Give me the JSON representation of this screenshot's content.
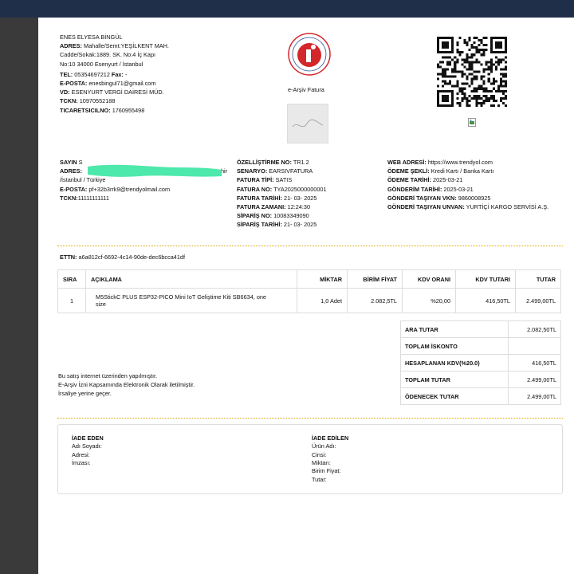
{
  "seller": {
    "name": "ENES ELYESA BİNGÜL",
    "address_label": "ADRES:",
    "address_lines": [
      "Mahalle/Semt:YEŞİLKENT MAH.",
      "Cadde/Sokak:1889. SK. No:4 İç Kapı",
      "No:10 34000 Esenyurt / İstanbul"
    ],
    "tel_label": "TEL:",
    "tel": "05354697212",
    "fax_label": "Fax:",
    "fax": "-",
    "email_label": "E-POSTA:",
    "email": "enesbingul71@gmail.com",
    "vd_label": "VD:",
    "vd": "ESENYURT VERGİ DAİRESİ MÜD.",
    "tckn_label": "TCKN:",
    "tckn": "10970552188",
    "ticsicil_label": "TICARETSICILNO:",
    "ticsicil": "1760955498"
  },
  "header": {
    "doc_type": "e-Arşiv Fatura"
  },
  "buyer": {
    "sayin_label": "SAYIN",
    "sayin_value": "S",
    "address_label": "ADRES:",
    "address_value": "hir",
    "address_line2": "/İstanbul / Türkiye",
    "email_label": "E-POSTA:",
    "email": "pf+32b3rrk9@trendyolmail.com",
    "tckn_label": "TCKN:",
    "tckn": "11111111111"
  },
  "invoice": {
    "rows": [
      {
        "label": "ÖZELLİŞTİRME NO:",
        "value": "TR1.2"
      },
      {
        "label": "SENARYO:",
        "value": "EARSIVFATURA"
      },
      {
        "label": "FATURA TİPİ:",
        "value": "SATIS"
      },
      {
        "label": "FATURA NO:",
        "value": "TYA2025000000001"
      },
      {
        "label": "FATURA TARİHİ:",
        "value": "21- 03- 2025"
      },
      {
        "label": "FATURA ZAMANI:",
        "value": "12:24:30"
      },
      {
        "label": "SİPARİŞ NO:",
        "value": "10083349090"
      },
      {
        "label": "SİPARİŞ TARİHİ:",
        "value": "21- 03- 2025"
      }
    ]
  },
  "shipping": {
    "rows": [
      {
        "label": "WEB ADRESİ:",
        "value": "https://www.trendyol.com"
      },
      {
        "label": "ÖDEME ŞEKLİ:",
        "value": "Kredi Kartı / Banka Kartı"
      },
      {
        "label": "ÖDEME TARİHİ:",
        "value": "2025-03-21"
      },
      {
        "label": "GÖNDERİM TARİHİ:",
        "value": "2025-03-21"
      },
      {
        "label": "GÖNDERİ TAŞIYAN VKN:",
        "value": "9860008925"
      },
      {
        "label": "GÖNDERİ TAŞIYAN UNVAN:",
        "value": "YURTİÇİ KARGO SERVİSİ A.Ş."
      }
    ]
  },
  "ettn": {
    "label": "ETTN:",
    "value": "a6a812cf-6692-4c14-90de-dec6bcca41df"
  },
  "items_table": {
    "headers": [
      "SIRA",
      "AÇIKLAMA",
      "MİKTAR",
      "BİRİM FİYAT",
      "KDV ORANI",
      "KDV TUTARI",
      "TUTAR"
    ],
    "rows": [
      {
        "sira": "1",
        "aciklama_1": "M5StickC PLUS ESP32-PICO Mini IoT Geliştime Kiti SB6634, one",
        "aciklama_2": "size",
        "miktar": "1,0 Adet",
        "birim_fiyat": "2.082,5TL",
        "kdv_orani": "%20,00",
        "kdv_tutari": "416,50TL",
        "tutar": "2.499,00TL"
      }
    ]
  },
  "totals": [
    {
      "label": "ARA TUTAR",
      "value": "2.082,50TL"
    },
    {
      "label": "TOPLAM İSKONTO",
      "value": ""
    },
    {
      "label": "HESAPLANAN KDV(%20.0)",
      "value": "416,50TL"
    },
    {
      "label": "TOPLAM TUTAR",
      "value": "2.499,00TL"
    },
    {
      "label": "ÖDENECEK TUTAR",
      "value": "2.499,00TL"
    }
  ],
  "notes": [
    "Bu satış internet üzerinden yapılmıştır.",
    "E-Arşiv İzni Kapsamında Elektronik Olarak iletilmiştir.",
    "İrsaliye yerine geçer."
  ],
  "return_section": {
    "left_title": "İADE EDEN",
    "left_fields": [
      "Adı Soyadı:",
      "Adresi:",
      "İmzası:"
    ],
    "right_title": "İADE EDİLEN",
    "right_fields": [
      "Ürün Adı:",
      "Cinsi:",
      "Miktarı:",
      "Birim Fiyat:",
      "Tutar:"
    ]
  },
  "colors": {
    "topbar": "#1f2f4a",
    "separator": "#d9a400",
    "logo_red": "#d3272c",
    "redaction": "#3ee6a4"
  }
}
